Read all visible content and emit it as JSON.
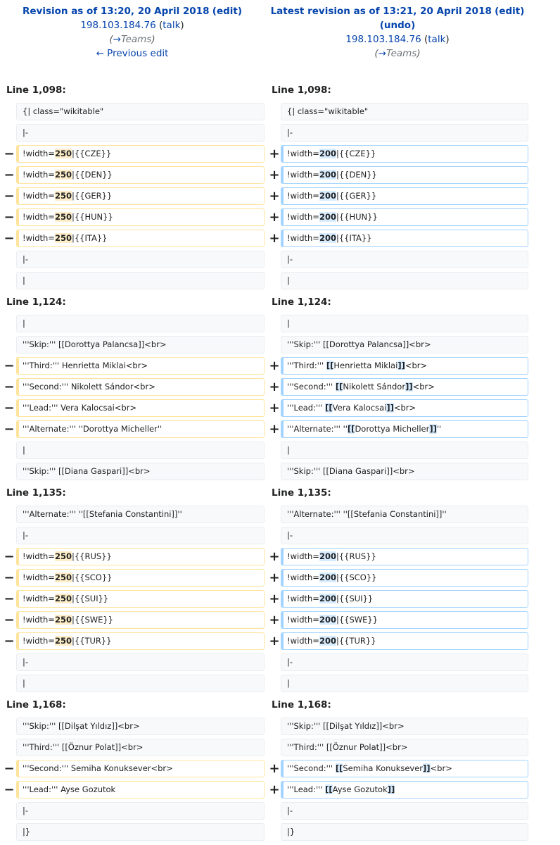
{
  "header": {
    "left": {
      "title": "Revision as of 13:20, 20 April 2018",
      "action": "edit",
      "user": "198.103.184.76",
      "talk": "talk",
      "comment_arrow": "→",
      "comment_section": "Teams",
      "prev_link": "← Previous edit"
    },
    "right": {
      "title": "Latest revision as of 13:21, 20 April 2018",
      "action": "edit",
      "undo": "undo",
      "user": "198.103.184.76",
      "talk": "talk",
      "comment_arrow": "→",
      "comment_section": "Teams"
    }
  },
  "diff": {
    "blocks": [
      {
        "line_label": "Line 1,098:",
        "rows": [
          {
            "type": "ctx",
            "text": "{| class=\"wikitable\""
          },
          {
            "type": "ctx",
            "text": "|-"
          },
          {
            "type": "chg",
            "old": [
              "!width=",
              "250",
              "|{{CZE}}"
            ],
            "new": [
              "!width=",
              "200",
              "|{{CZE}}"
            ]
          },
          {
            "type": "chg",
            "old": [
              "!width=",
              "250",
              "|{{DEN}}"
            ],
            "new": [
              "!width=",
              "200",
              "|{{DEN}}"
            ]
          },
          {
            "type": "chg",
            "old": [
              "!width=",
              "250",
              "|{{GER}}"
            ],
            "new": [
              "!width=",
              "200",
              "|{{GER}}"
            ]
          },
          {
            "type": "chg",
            "old": [
              "!width=",
              "250",
              "|{{HUN}}"
            ],
            "new": [
              "!width=",
              "200",
              "|{{HUN}}"
            ]
          },
          {
            "type": "chg",
            "old": [
              "!width=",
              "250",
              "|{{ITA}}"
            ],
            "new": [
              "!width=",
              "200",
              "|{{ITA}}"
            ]
          },
          {
            "type": "ctx",
            "text": "|-"
          },
          {
            "type": "ctx",
            "text": "|"
          }
        ]
      },
      {
        "line_label": "Line 1,124:",
        "rows": [
          {
            "type": "ctx",
            "text": "|"
          },
          {
            "type": "ctx",
            "text": "'''Skip:''' [[Dorottya Palancsa]]<br>"
          },
          {
            "type": "chg",
            "old": [
              "'''Third:''' Henrietta Miklai<br>"
            ],
            "new": [
              "'''Third:''' ",
              "[[",
              "Henrietta Miklai",
              "]]",
              "<br>"
            ]
          },
          {
            "type": "chg",
            "old": [
              "'''Second:''' Nikolett Sándor<br>"
            ],
            "new": [
              "'''Second:''' ",
              "[[",
              "Nikolett Sándor",
              "]]",
              "<br>"
            ]
          },
          {
            "type": "chg",
            "old": [
              "'''Lead:''' Vera Kalocsai<br>"
            ],
            "new": [
              "'''Lead:''' ",
              "[[",
              "Vera Kalocsai",
              "]]",
              "<br>"
            ]
          },
          {
            "type": "chg",
            "old": [
              "'''Alternate:''' ''Dorottya Micheller''"
            ],
            "new": [
              "'''Alternate:''' ''",
              "[[",
              "Dorottya Micheller",
              "]]",
              "''"
            ]
          },
          {
            "type": "ctx",
            "text": "|"
          },
          {
            "type": "ctx",
            "text": "'''Skip:''' [[Diana Gaspari]]<br>"
          }
        ]
      },
      {
        "line_label": "Line 1,135:",
        "rows": [
          {
            "type": "ctx",
            "text": "'''Alternate:''' ''[[Stefania Constantini]]''"
          },
          {
            "type": "ctx",
            "text": "|-"
          },
          {
            "type": "chg",
            "old": [
              "!width=",
              "250",
              "|{{RUS}}"
            ],
            "new": [
              "!width=",
              "200",
              "|{{RUS}}"
            ]
          },
          {
            "type": "chg",
            "old": [
              "!width=",
              "250",
              "|{{SCO}}"
            ],
            "new": [
              "!width=",
              "200",
              "|{{SCO}}"
            ]
          },
          {
            "type": "chg",
            "old": [
              "!width=",
              "250",
              "|{{SUI}}"
            ],
            "new": [
              "!width=",
              "200",
              "|{{SUI}}"
            ]
          },
          {
            "type": "chg",
            "old": [
              "!width=",
              "250",
              "|{{SWE}}"
            ],
            "new": [
              "!width=",
              "200",
              "|{{SWE}}"
            ]
          },
          {
            "type": "chg",
            "old": [
              "!width=",
              "250",
              "|{{TUR}}"
            ],
            "new": [
              "!width=",
              "200",
              "|{{TUR}}"
            ]
          },
          {
            "type": "ctx",
            "text": "|-"
          },
          {
            "type": "ctx",
            "text": "|"
          }
        ]
      },
      {
        "line_label": "Line 1,168:",
        "rows": [
          {
            "type": "ctx",
            "text": "'''Skip:''' [[Dilşat Yıldız]]<br>"
          },
          {
            "type": "ctx",
            "text": "'''Third:''' [[Öznur Polat]]<br>"
          },
          {
            "type": "chg",
            "old": [
              "'''Second:''' Semiha Konuksever<br>"
            ],
            "new": [
              "'''Second:''' ",
              "[[",
              "Semiha Konuksever",
              "]]",
              "<br>"
            ]
          },
          {
            "type": "chg",
            "old": [
              "'''Lead:''' Ayse Gozutok"
            ],
            "new": [
              "'''Lead:''' ",
              "[[",
              "Ayse Gozutok",
              "]]"
            ]
          },
          {
            "type": "ctx",
            "text": "|-"
          },
          {
            "type": "ctx",
            "text": "|}"
          }
        ]
      }
    ],
    "minus_sign": "−",
    "plus_sign": "+"
  },
  "colors": {
    "deleted_border": "#ffe49c",
    "added_border": "#a3d3ff",
    "context_bg": "#f8f9fa",
    "link": "#0645ad"
  }
}
